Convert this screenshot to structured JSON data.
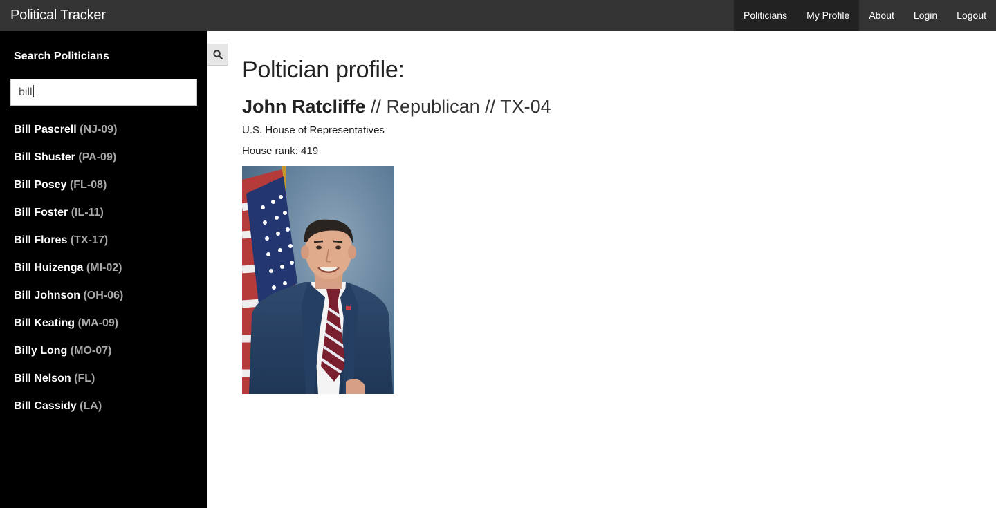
{
  "navbar": {
    "brand": "Political Tracker",
    "items": [
      {
        "label": "Politicians",
        "active": true
      },
      {
        "label": "My Profile",
        "active": true
      },
      {
        "label": "About",
        "active": false
      },
      {
        "label": "Login",
        "active": false
      },
      {
        "label": "Logout",
        "active": false
      }
    ]
  },
  "sidebar": {
    "title": "Search Politicians",
    "search_value": "bill",
    "results": [
      {
        "name": "Bill Pascrell",
        "district": "(NJ-09)"
      },
      {
        "name": "Bill Shuster",
        "district": "(PA-09)"
      },
      {
        "name": "Bill Posey",
        "district": "(FL-08)"
      },
      {
        "name": "Bill Foster",
        "district": "(IL-11)"
      },
      {
        "name": "Bill Flores",
        "district": "(TX-17)"
      },
      {
        "name": "Bill Huizenga",
        "district": "(MI-02)"
      },
      {
        "name": "Bill Johnson",
        "district": "(OH-06)"
      },
      {
        "name": "Bill Keating",
        "district": "(MA-09)"
      },
      {
        "name": "Billy Long",
        "district": "(MO-07)"
      },
      {
        "name": "Bill Nelson",
        "district": "(FL)"
      },
      {
        "name": "Bill Cassidy",
        "district": "(LA)"
      }
    ]
  },
  "toggle_icon": "search-icon",
  "main": {
    "heading": "Poltician profile:",
    "name": "John Ratcliffe",
    "details": " // Republican // TX-04",
    "chamber": "U.S. House of Representatives",
    "rank": "House rank: 419"
  },
  "colors": {
    "navbar_bg": "#333333",
    "navbar_active": "#222222",
    "sidebar_bg": "#000000",
    "district_text": "#a8a8a8"
  }
}
